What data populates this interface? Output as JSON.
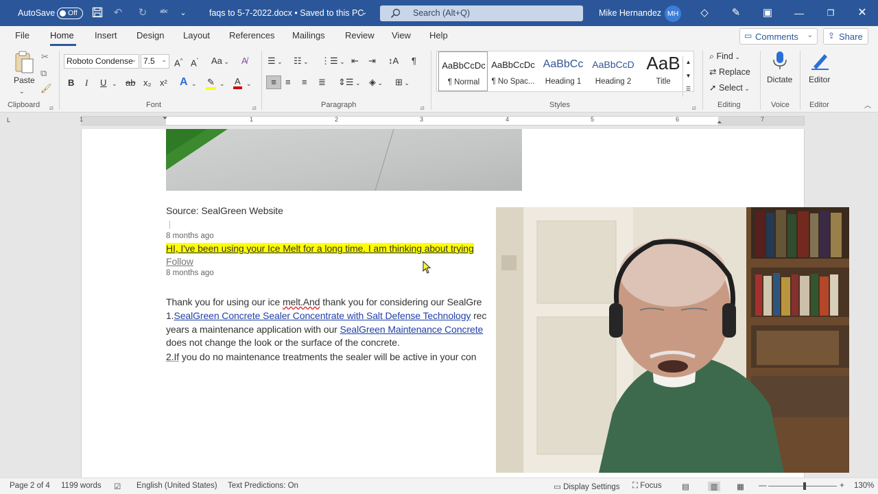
{
  "titlebar": {
    "autosave_label": "AutoSave",
    "autosave_state": "Off",
    "doc_title": "faqs to 5-7-2022.docx • Saved to this PC",
    "search_placeholder": "Search (Alt+Q)",
    "user_name": "Mike Hernandez",
    "user_initials": "MH",
    "bar_color": "#2b579a"
  },
  "tabs": [
    "File",
    "Home",
    "Insert",
    "Design",
    "Layout",
    "References",
    "Mailings",
    "Review",
    "View",
    "Help"
  ],
  "active_tab": "Home",
  "comments_label": "Comments",
  "share_label": "Share",
  "ribbon": {
    "clipboard": {
      "paste_label": "Paste",
      "group_label": "Clipboard"
    },
    "font": {
      "font_name": "Roboto Condense",
      "font_size": "7.5",
      "group_label": "Font",
      "bold": "B",
      "italic": "I",
      "underline": "U",
      "strike": "ab",
      "sub": "x₂",
      "sup": "x²",
      "aa": "Aa"
    },
    "paragraph": {
      "group_label": "Paragraph",
      "pilcrow": "¶"
    },
    "styles": {
      "group_label": "Styles",
      "items": [
        {
          "preview": "AaBbCcDc",
          "name": "¶ Normal"
        },
        {
          "preview": "AaBbCcDc",
          "name": "¶ No Spac..."
        },
        {
          "preview": "AaBbCc",
          "name": "Heading 1"
        },
        {
          "preview": "AaBbCcD",
          "name": "Heading 2"
        },
        {
          "preview": "AaB",
          "name": "Title"
        }
      ]
    },
    "editing": {
      "group_label": "Editing",
      "find": "Find",
      "replace": "Replace",
      "select": "Select"
    },
    "voice": {
      "group_label": "Voice",
      "dictate": "Dictate"
    },
    "editor": {
      "group_label": "Editor",
      "editor": "Editor"
    }
  },
  "ruler": {
    "numbers": [
      "1",
      "1",
      "2",
      "3",
      "4",
      "5",
      "6",
      "7"
    ],
    "corner": "L"
  },
  "document": {
    "source_line": "Source: SealGreen Website",
    "time1": "8 months ago",
    "highlight_line": "HI, I've been using your Ice Melt for a long time. I am thinking about trying",
    "follow": "Follow",
    "time2": "8 months ago",
    "reply_a": "Thank you for using our ice ",
    "reply_b": "melt.And",
    "reply_c": " thank you for considering our SealGre",
    "item1_num": "1.",
    "item1_link": "SealGreen Concrete Sealer Concentrate with Salt Defense Technology",
    "item1_rest": " rec",
    "line3_a": "years a maintenance application with our ",
    "line3_link": "SealGreen Maintenance Concrete",
    "line4": "does not change the look or the surface of the concrete.",
    "item2_a": "2.If",
    "item2_b": " you do no maintenance treatments the sealer will be active in your con"
  },
  "statusbar": {
    "page": "Page 2 of 4",
    "words": "1199 words",
    "language": "English (United States)",
    "predictions": "Text Predictions: On",
    "display_settings": "Display Settings",
    "focus": "Focus",
    "zoom": "130%"
  }
}
